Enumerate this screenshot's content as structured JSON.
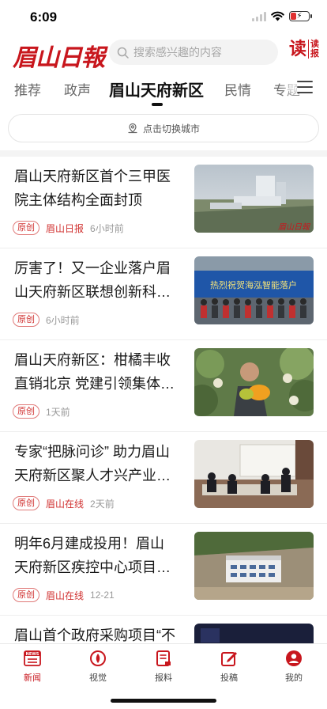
{
  "status_bar": {
    "time": "6:09"
  },
  "header": {
    "logo_text": "眉山日報",
    "search_placeholder": "搜索感兴趣的内容",
    "read_big": "读",
    "read_small_1": "读",
    "read_small_2": "报"
  },
  "tabs": [
    {
      "label": "推荐"
    },
    {
      "label": "政声"
    },
    {
      "label": "眉山天府新区",
      "active": true
    },
    {
      "label": "民情"
    },
    {
      "label": "专题"
    }
  ],
  "city_switch": {
    "label": "点击切换城市"
  },
  "news": [
    {
      "title": "眉山天府新区首个三甲医院主体结构全面封顶",
      "tag": "原创",
      "source": "眉山日报",
      "time": "6小时前"
    },
    {
      "title": "厉害了！又一企业落户眉山天府新区联想创新科技…",
      "tag": "原创",
      "source": "",
      "time": "6小时前",
      "thumb_banner": "热烈祝贺海泓智能落户"
    },
    {
      "title": "眉山天府新区：柑橘丰收直销北京 党建引领集体经济…",
      "tag": "原创",
      "source": "",
      "time": "1天前"
    },
    {
      "title": "专家“把脉问诊” 助力眉山天府新区聚人才兴产业…",
      "tag": "原创",
      "source": "眉山在线",
      "time": "2天前"
    },
    {
      "title": "明年6月建成投用！眉山天府新区疾控中心项目主体…",
      "tag": "原创",
      "source": "眉山在线",
      "time": "12-21"
    },
    {
      "title": "眉山首个政府采购项目“不见面”开标",
      "tag": "",
      "source": "",
      "time": ""
    }
  ],
  "bottom_nav": [
    {
      "label": "新闻",
      "icon": "news-icon",
      "active": true
    },
    {
      "label": "视觉",
      "icon": "eye-icon"
    },
    {
      "label": "报料",
      "icon": "report-icon"
    },
    {
      "label": "投稿",
      "icon": "edit-icon"
    },
    {
      "label": "我的",
      "icon": "profile-icon"
    }
  ],
  "colors": {
    "accent": "#c8161d",
    "tag_red": "#d0302f"
  }
}
